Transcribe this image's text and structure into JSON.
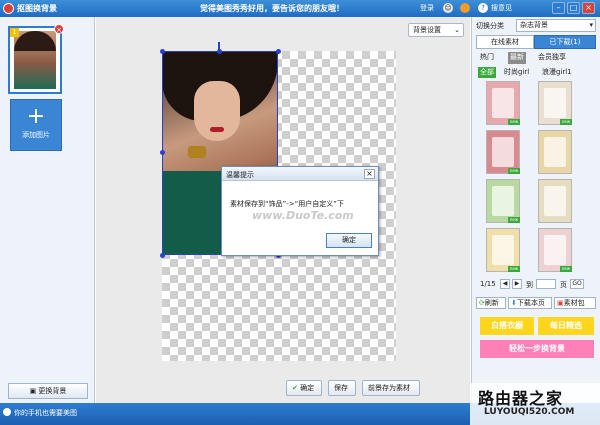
{
  "titlebar": {
    "app_title": "抠图换背景",
    "slogan": "觉得美图秀秀好用，要告诉您的朋友哦！",
    "login_label": "登录",
    "feedback_label": "搜意见",
    "color_accent": "#1f6cc2"
  },
  "leftpanel": {
    "thumb_number": "1",
    "add_image_label": "添加图片",
    "change_bg_label": "更换背景"
  },
  "canvas": {
    "bg_settings_label": "背景设置"
  },
  "bottom_buttons": {
    "confirm_label": "确定",
    "save_label": "保存",
    "save_foreground_label": "前景存为素材"
  },
  "dialog": {
    "title": "温馨提示",
    "message": "素材保存到“饰品”->“用户自定义”下",
    "watermark": "www.DuoTe.com",
    "ok_label": "确定"
  },
  "rightpanel": {
    "category_label": "切换分类",
    "category_value": "杂志背景",
    "tabs": [
      "在线素材",
      "已下载(1)"
    ],
    "subtabs": [
      "热门",
      "最新",
      "会员独享"
    ],
    "filters": [
      "全部",
      "时尚girl",
      "浪漫girl1"
    ],
    "tiles": [
      {
        "color": "#e7a9ae",
        "new": true
      },
      {
        "color": "#e9dfd1",
        "new": true
      },
      {
        "color": "#d98a8f",
        "new": true
      },
      {
        "color": "#e8d6a8",
        "new": false
      },
      {
        "color": "#b9d9a0",
        "new": true
      },
      {
        "color": "#e6dcc0",
        "new": false
      },
      {
        "color": "#f0dfa8",
        "new": true
      },
      {
        "color": "#eed2d2",
        "new": true
      }
    ],
    "pager": {
      "page_info": "1/15",
      "goto_label": "到",
      "page_suffix": "页",
      "go_label": "GO"
    },
    "actions": {
      "refresh_label": "刷新",
      "download_page_label": "下载本页",
      "material_pack_label": "素材包"
    },
    "promos": [
      {
        "label": "白搭衣橱",
        "color": "#ffd51e"
      },
      {
        "label": "每日精选",
        "color": "#ffd51e"
      },
      {
        "label": "轻松一步换背景",
        "color": "#ff7fb7"
      }
    ]
  },
  "statusbar": {
    "text": "你的手机也需要美图"
  },
  "brand": {
    "name": "路由器之家",
    "url": "LUYOUQI520.COM"
  }
}
